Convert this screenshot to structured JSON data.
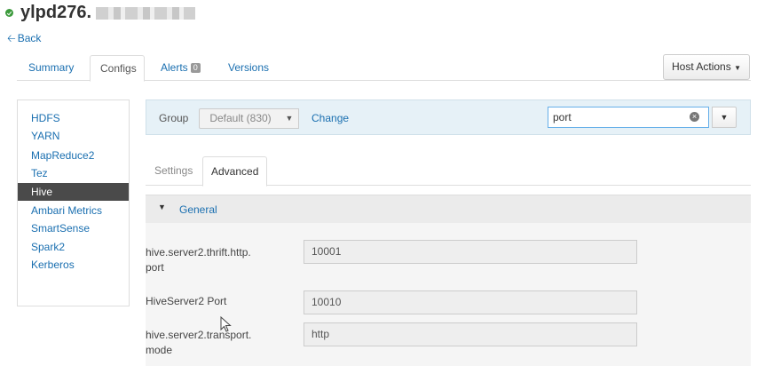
{
  "header": {
    "host_name": "ylpd276.",
    "status_icon": "green-check-icon",
    "status_color": "#3c9a3c",
    "back_label": "Back",
    "back_icon": "arrow-left-icon"
  },
  "tabs": [
    {
      "label": "Summary",
      "active": false
    },
    {
      "label": "Configs",
      "active": true
    },
    {
      "label": "Alerts",
      "badge": "0",
      "active": false
    },
    {
      "label": "Versions",
      "active": false
    }
  ],
  "host_actions": {
    "label": "Host Actions",
    "icon": "caret-down-icon"
  },
  "services": [
    {
      "label": "HDFS",
      "active": false
    },
    {
      "label": "YARN",
      "active": false
    },
    {
      "label": "MapReduce2",
      "active": false
    },
    {
      "label": "Tez",
      "active": false
    },
    {
      "label": "Hive",
      "active": true
    },
    {
      "label": "Ambari Metrics",
      "active": false
    },
    {
      "label": "SmartSense",
      "active": false
    },
    {
      "label": "Spark2",
      "active": false
    },
    {
      "label": "Kerberos",
      "active": false
    }
  ],
  "group_bar": {
    "group_label": "Group",
    "group_value": "Default (830)",
    "change_label": "Change",
    "search_value": "port"
  },
  "sub_tabs": [
    {
      "label": "Settings",
      "active": false
    },
    {
      "label": "Advanced",
      "active": true
    }
  ],
  "section": {
    "title": "General"
  },
  "properties": [
    {
      "name_line1": "hive.server2.thrift.http.",
      "name_line2": "port",
      "value": "10001"
    },
    {
      "name_line1": "HiveServer2 Port",
      "name_line2": "",
      "value": "10010"
    },
    {
      "name_line1": "hive.server2.transport.",
      "name_line2": "mode",
      "value": "http"
    }
  ],
  "colors": {
    "link": "#1a6fb0",
    "active_nav_bg": "#4a4a4a",
    "group_bar_bg": "#e6f1f7"
  }
}
